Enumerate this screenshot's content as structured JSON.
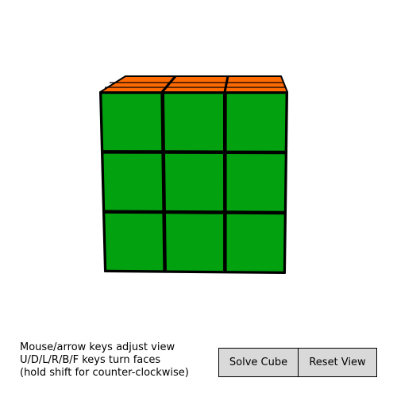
{
  "cube": {
    "colors": {
      "front": "#02a110",
      "top": "#ff6a00",
      "edge": "#000000"
    },
    "front_face_rows": 3,
    "front_face_cols": 3
  },
  "instructions": [
    "Mouse/arrow keys adjust view",
    "U/D/L/R/B/F keys turn faces",
    "(hold shift for counter-clockwise)"
  ],
  "buttons": {
    "solve_label": "Solve Cube",
    "reset_label": "Reset View"
  }
}
